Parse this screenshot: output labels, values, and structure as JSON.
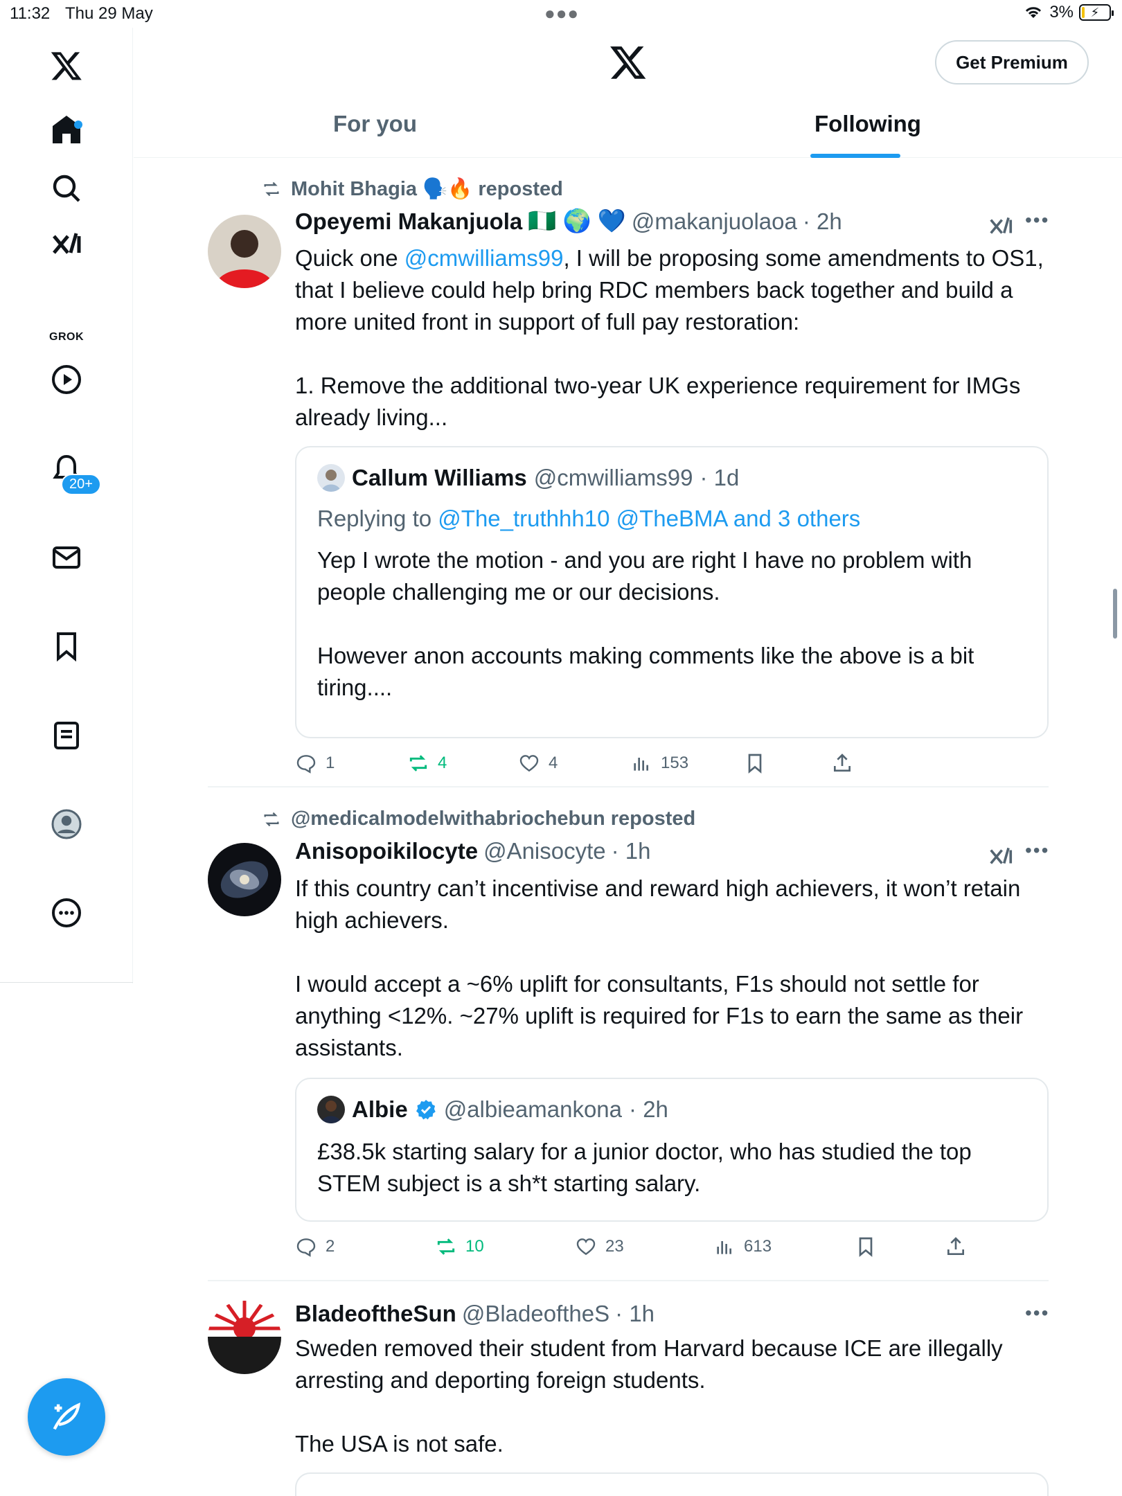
{
  "status_bar": {
    "time": "11:32",
    "date": "Thu 29 May",
    "battery_pct": "3%"
  },
  "header": {
    "premium_label": "Get Premium"
  },
  "tabs": [
    {
      "label": "For you"
    },
    {
      "label": "Following"
    }
  ],
  "sidebar": {
    "grok_label": "GROK",
    "notification_count": "20+",
    "items": [
      "home-icon",
      "search-icon",
      "grok-icon",
      "video-icon",
      "notifications-icon",
      "messages-icon",
      "bookmarks-icon",
      "lists-icon",
      "profile-icon",
      "more-icon"
    ]
  },
  "tweets": [
    {
      "repost_by": "Mohit Bhagia 🗣️🔥 reposted",
      "name": "Opeyemi Makanjuola",
      "badges": "🇳🇬 🌍 💙",
      "handle": "@makanjuolaoa",
      "time": "· 2h",
      "body_pre": "Quick one ",
      "body_mention": "@cmwilliams99",
      "body_post": ", I will be proposing some amendments to OS1, that I believe could help bring RDC members back together and build a more united front in support of full pay restoration:",
      "body_p2": "1. Remove the additional two-year UK experience requirement for IMGs already living...",
      "quote": {
        "name": "Callum Williams",
        "handle": "@cmwilliams99",
        "time": "· 1d",
        "reply_prefix": "Replying to",
        "reply_targets": "@The_truthhh10 @TheBMA and 3 others",
        "p1": "Yep I wrote the motion - and you are right I have no problem with people challenging me or our decisions.",
        "p2": "However anon accounts making comments like the above is a bit tiring...."
      },
      "stats": {
        "replies": "1",
        "reposts": "4",
        "likes": "4",
        "views": "153"
      }
    },
    {
      "repost_by": "@medicalmodelwithabriochebun reposted",
      "name": "Anisopoikilocyte",
      "handle": "@Anisocyte",
      "time": "· 1h",
      "p1": "If this country can’t incentivise and reward high achievers, it won’t retain high achievers.",
      "p2": "I would accept a ~6% uplift for consultants, F1s should not settle for anything <12%. ~27% uplift is required for F1s to earn the same as their assistants.",
      "quote": {
        "name": "Albie",
        "handle": "@albieamankona",
        "time": "· 2h",
        "p1": "£38.5k starting salary for a junior doctor, who has studied the top STEM subject is a sh*t starting salary."
      },
      "stats": {
        "replies": "2",
        "reposts": "10",
        "likes": "23",
        "views": "613"
      }
    },
    {
      "name": "BladeoftheSun",
      "handle": "@BladeoftheS",
      "time": "· 1h",
      "p1": "Sweden removed their student from Harvard because ICE are illegally arresting and deporting foreign students.",
      "p2": "The USA is not safe.",
      "avatar_text": "Blade of the Sun"
    }
  ],
  "colors": {
    "accent": "#1d9bf0",
    "repost_green": "#00ba7c",
    "muted": "#536471"
  }
}
